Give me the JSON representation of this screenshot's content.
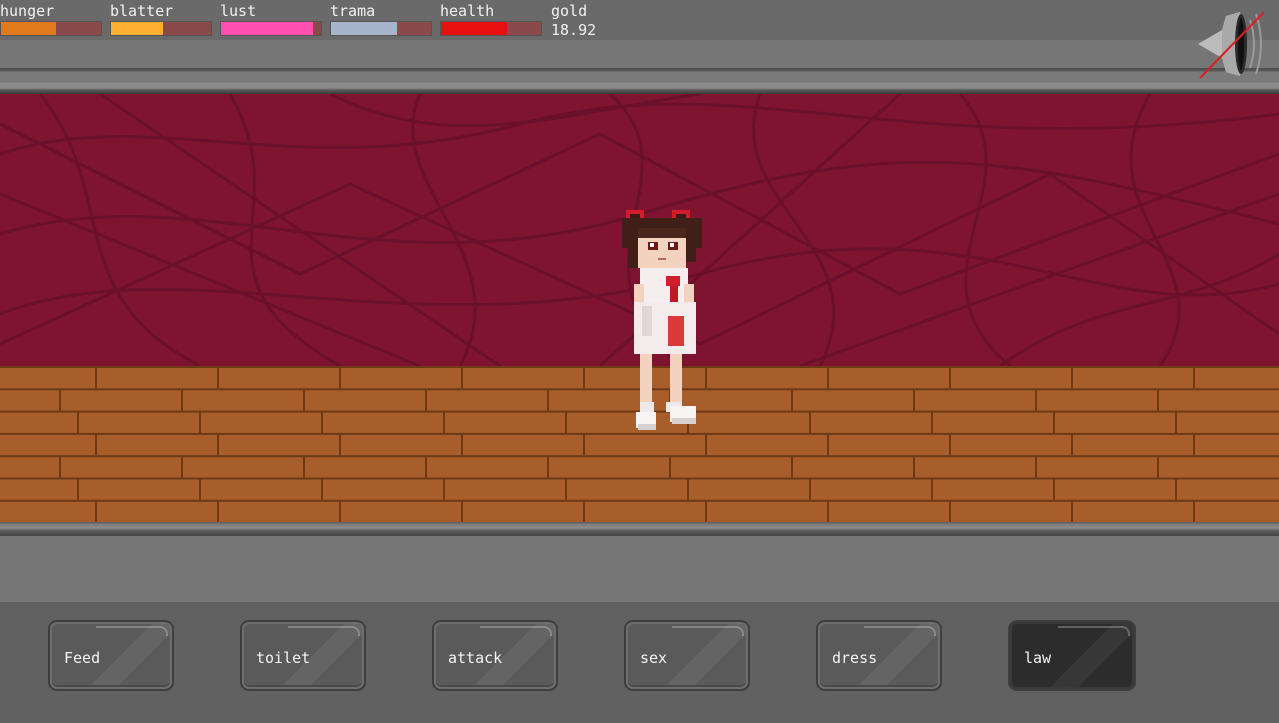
{
  "stats": [
    {
      "label": "hunger",
      "level": 0.55,
      "color": "#e07a1c"
    },
    {
      "label": "blatter",
      "level": 0.52,
      "color": "#ffb030"
    },
    {
      "label": "lust",
      "level": 0.92,
      "color": "#ff4fb0"
    },
    {
      "label": "trama",
      "level": 0.66,
      "color": "#a8b4cc"
    },
    {
      "label": "health",
      "level": 0.66,
      "color": "#e81010"
    }
  ],
  "gold": {
    "label": "gold",
    "value": "18.92"
  },
  "sound": {
    "icon": "speaker-muted-icon"
  },
  "actions": [
    {
      "label": "Feed"
    },
    {
      "label": "toilet"
    },
    {
      "label": "attack"
    },
    {
      "label": "sex"
    },
    {
      "label": "dress"
    },
    {
      "label": "law",
      "selected": true
    }
  ],
  "scene": {
    "character": "girl-sprite",
    "wall_color": "#7e1430",
    "floor_color": "#a85e2a"
  }
}
